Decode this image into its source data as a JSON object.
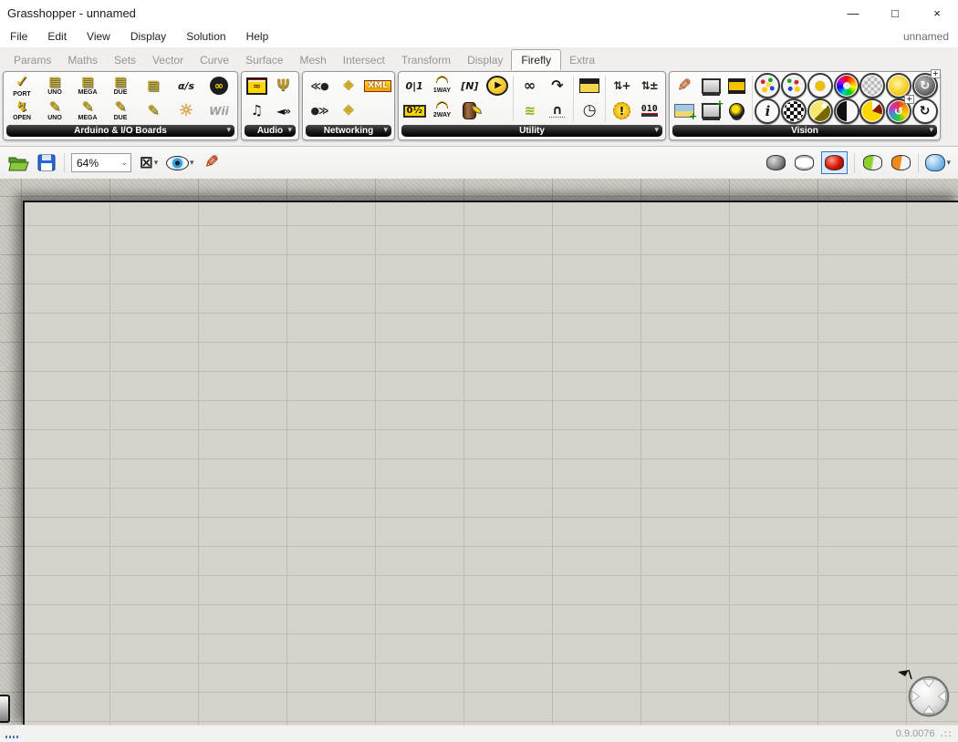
{
  "window": {
    "title": "Grasshopper - unnamed",
    "controls": [
      {
        "id": "minimize",
        "glyph": "—"
      },
      {
        "id": "maximize",
        "glyph": "□"
      },
      {
        "id": "close",
        "glyph": "×"
      }
    ]
  },
  "menu": {
    "items": [
      "File",
      "Edit",
      "View",
      "Display",
      "Solution",
      "Help"
    ],
    "right_label": "unnamed"
  },
  "tabs": {
    "items": [
      "Params",
      "Maths",
      "Sets",
      "Vector",
      "Curve",
      "Surface",
      "Mesh",
      "Intersect",
      "Transform",
      "Display",
      "Firefly",
      "Extra"
    ],
    "active": "Firefly"
  },
  "ribbon": {
    "arrow_glyph": "▾",
    "groups": [
      {
        "label": "Arduino & I/O Boards",
        "slug": "arduino-io-boards",
        "cols": [
          {
            "t": {
              "id": "ports-available",
              "glyph": "✓",
              "cls": "g-check",
              "cap": "PORT"
            },
            "b": {
              "id": "open-port",
              "glyph": "↯",
              "cls": "g-plug",
              "cap": "OPEN"
            }
          },
          {
            "t": {
              "id": "uno-read",
              "glyph": "▤",
              "cls": "g-read",
              "cap": "UNO"
            },
            "b": {
              "id": "uno-write",
              "glyph": "✎",
              "cls": "g-write",
              "cap": "UNO"
            }
          },
          {
            "t": {
              "id": "mega-read",
              "glyph": "▤",
              "cls": "g-read",
              "cap": "MEGA"
            },
            "b": {
              "id": "mega-write",
              "glyph": "✎",
              "cls": "g-write",
              "cap": "MEGA"
            }
          },
          {
            "t": {
              "id": "due-read",
              "glyph": "▤",
              "cls": "g-read",
              "cap": "DUE"
            },
            "b": {
              "id": "due-write",
              "glyph": "✎",
              "cls": "g-write",
              "cap": "DUE"
            }
          },
          {
            "t": {
              "id": "generic-read",
              "glyph": "▤",
              "cls": "g-read"
            },
            "b": {
              "id": "generic-write",
              "glyph": "✎",
              "cls": "g-write"
            }
          },
          {
            "t": {
              "id": "serial-string",
              "glyph": "α/s",
              "cls": "g-text"
            },
            "b": {
              "id": "firmata-gear",
              "glyph": "☼",
              "cls": "g-sun"
            }
          },
          {
            "t": {
              "id": "arduino-logo",
              "glyph": "∞",
              "cls": "g-ard"
            },
            "b": {
              "id": "wii-nunchuck",
              "glyph": "Wii",
              "cls": "g-wii"
            }
          }
        ]
      },
      {
        "label": "Audio",
        "slug": "audio",
        "cols": [
          {
            "t": {
              "id": "spectrum-analyzer",
              "glyph": "≈",
              "cls": "g-wavebox"
            },
            "b": {
              "id": "frequency-note",
              "glyph": "♫",
              "cls": "g-notebox"
            }
          },
          {
            "t": {
              "id": "microphone",
              "glyph": "Ψ",
              "cls": "g-mic"
            },
            "b": {
              "id": "speaker-out",
              "glyph": "◄»",
              "cls": "g-speaker"
            }
          }
        ]
      },
      {
        "label": "Networking",
        "slug": "networking",
        "cols": [
          {
            "t": {
              "id": "wireless-receive",
              "glyph": "≪●",
              "cls": "g-net"
            },
            "b": {
              "id": "wireless-send",
              "glyph": "●≫",
              "cls": "g-net"
            }
          },
          {
            "t": {
              "id": "network-hub-out",
              "glyph": "❖",
              "cls": "g-hub"
            },
            "b": {
              "id": "network-hub-in",
              "glyph": "❖",
              "cls": "g-hub"
            }
          },
          {
            "t": {
              "id": "xml-search",
              "glyph": "XML",
              "cls": "g-xml"
            },
            "b": {
              "id": "networking-empty",
              "empty": true
            }
          }
        ]
      },
      {
        "label": "Utility",
        "slug": "utility",
        "cols": [
          {
            "t": {
              "id": "toggle-switch",
              "glyph": "0|1",
              "cls": "g-text"
            },
            "b": {
              "id": "counter",
              "glyph": "0½",
              "cls": "g-box"
            }
          },
          {
            "t": {
              "id": "one-way-gauge",
              "glyph": "◠",
              "cls": "g-gauge",
              "cap": "1WAY"
            },
            "b": {
              "id": "two-way-gauge",
              "glyph": "◠",
              "cls": "g-gauge",
              "cap": "2WAY"
            }
          },
          {
            "t": {
              "id": "smooth-data",
              "glyph": "[N]",
              "cls": "g-text"
            },
            "b": {
              "id": "data-buffer",
              "glyph": "",
              "cls": "g-barrel"
            }
          },
          {
            "t": {
              "id": "play-animation",
              "glyph": "▶",
              "cls": "g-playcircle"
            },
            "b": {
              "id": "utility-empty-1",
              "empty": true
            }
          },
          {
            "divider": true
          },
          {
            "t": {
              "id": "constrain-cuffs",
              "glyph": "∞",
              "cls": "g-dark"
            },
            "b": {
              "id": "graph-curves",
              "glyph": "≋",
              "cls": "g-birds"
            }
          },
          {
            "t": {
              "id": "remap-curve",
              "glyph": "↷",
              "cls": "g-dark"
            },
            "b": {
              "id": "bell-curve",
              "glyph": "∩",
              "cls": "g-bell"
            }
          },
          {
            "divider": true
          },
          {
            "t": {
              "id": "frame-recorder",
              "glyph": "",
              "cls": "g-clapper"
            },
            "b": {
              "id": "stopwatch",
              "glyph": "◷",
              "cls": "g-stopwatch"
            }
          },
          {
            "divider": true
          },
          {
            "t": {
              "id": "state-increment",
              "glyph": "⇅+",
              "cls": "g-updown"
            },
            "b": {
              "id": "alert-flash",
              "glyph": "!",
              "cls": "g-burst"
            }
          },
          {
            "t": {
              "id": "state-decrement",
              "glyph": "⇅±",
              "cls": "g-updown"
            },
            "b": {
              "id": "binary-sequence",
              "glyph": "010",
              "cls": "g-binary"
            }
          }
        ]
      },
      {
        "label": "Vision",
        "slug": "vision",
        "cols": [
          {
            "t": {
              "id": "paintbrush",
              "glyph": "✎",
              "cls": "g-brush"
            },
            "b": {
              "id": "image-import",
              "glyph": "",
              "cls": "g-image"
            }
          },
          {
            "t": {
              "id": "screen-capture",
              "glyph": "",
              "cls": "g-screencap"
            },
            "b": {
              "id": "camera-capture",
              "glyph": "",
              "cls": "g-camplus"
            }
          },
          {
            "t": {
              "id": "video-player",
              "glyph": "",
              "cls": "g-film"
            },
            "b": {
              "id": "webcam",
              "glyph": "",
              "cls": "g-webcam"
            }
          },
          {
            "divider": true
          },
          {
            "t": {
              "id": "color-sampler",
              "glyph": "",
              "cls": "vc v-dots-a"
            },
            "b": {
              "id": "image-info",
              "glyph": "i",
              "cls": "vc v-info"
            }
          },
          {
            "t": {
              "id": "color-palette",
              "glyph": "",
              "cls": "vc v-dots-b"
            },
            "b": {
              "id": "checkerboard-filter",
              "glyph": "",
              "cls": "vc v-checker"
            }
          },
          {
            "t": {
              "id": "droplet-filter",
              "glyph": "●",
              "cls": "vc v-droplet"
            },
            "b": {
              "id": "threshold-spot",
              "glyph": "",
              "cls": "vc v-spot"
            }
          },
          {
            "t": {
              "id": "color-wheel",
              "glyph": "",
              "cls": "vc v-wheel"
            },
            "b": {
              "id": "contrast-filter",
              "glyph": "",
              "cls": "vc v-contrast"
            }
          },
          {
            "t": {
              "id": "mosaic-filter",
              "glyph": "",
              "cls": "vc v-mosaic"
            },
            "b": {
              "id": "pie-crop",
              "glyph": "",
              "cls": "vc v-pie"
            }
          },
          {
            "t": {
              "id": "brightness-filter",
              "glyph": "",
              "cls": "vc v-bright"
            },
            "b": {
              "id": "swirl-filter",
              "glyph": "↺",
              "cls": "vc v-swirl plus"
            }
          },
          {
            "t": {
              "id": "rotate-image",
              "glyph": "↻",
              "cls": "vc v-rotplus plus"
            },
            "b": {
              "id": "refresh-image",
              "glyph": "↻",
              "cls": "vc v-refresh"
            }
          }
        ]
      }
    ]
  },
  "toolbar": {
    "zoom_value": "64%",
    "caret_glyph": "▾",
    "combo_caret_glyph": "⌄",
    "zoom_extents_glyph": "⊠",
    "sketch_glyph": "✎"
  },
  "statusbar": {
    "version": "0.9.0076",
    "grip": ".::"
  },
  "colors": {
    "accent_yellow": "#ffd700",
    "selected_preview_red": "#d31500",
    "selection_border_blue": "#3a74c0",
    "canvas_paper": "#d6d3cd",
    "canvas_pasteboard": "#c9c6c0",
    "group_label_bg": "#1a1a1a"
  }
}
